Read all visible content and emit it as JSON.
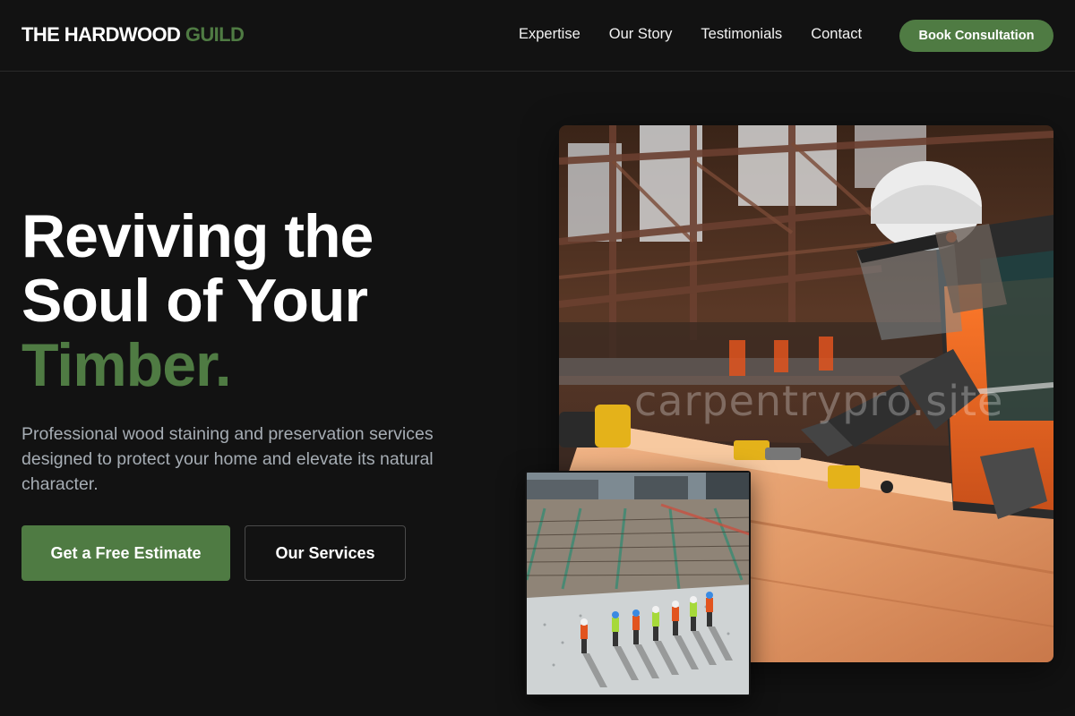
{
  "header": {
    "logo_main": "THE HARDWOOD ",
    "logo_accent": "GUILD",
    "nav": [
      "Expertise",
      "Our Story",
      "Testimonials",
      "Contact"
    ],
    "cta": "Book Consultation"
  },
  "hero": {
    "title_line1": "Reviving the",
    "title_line2": "Soul of Your",
    "title_accent": "Timber.",
    "subtitle": "Professional wood staining and preservation services designed to protect your home and elevate its natural character.",
    "primary_button": "Get a Free Estimate",
    "secondary_button": "Our Services"
  },
  "images": {
    "main_watermark": "carpentrypro.site"
  },
  "colors": {
    "background": "#121212",
    "accent": "#4f7b43",
    "text": "#ffffff",
    "muted_text": "#a6adb4"
  }
}
